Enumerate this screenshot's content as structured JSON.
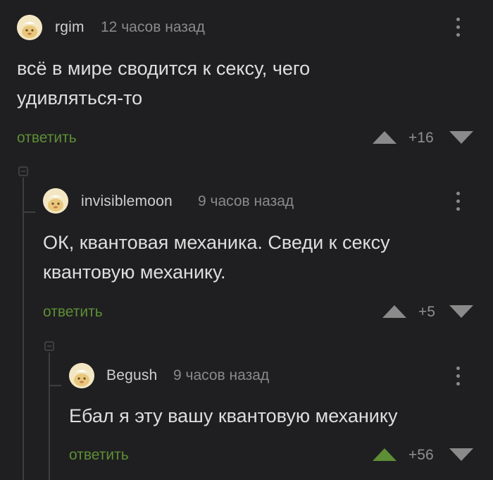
{
  "comments": [
    {
      "username": "rgim",
      "time": "12 часов назад",
      "text": "всё в мире сводится к сексу, чего удивляться-то",
      "reply_label": "ответить",
      "rating": "+16",
      "upvoted": false
    },
    {
      "username": "invisiblemoon",
      "time": "9 часов назад",
      "text": "ОК, квантовая механика. Сведи к сексу квантовую механику.",
      "reply_label": "ответить",
      "rating": "+5",
      "upvoted": false
    },
    {
      "username": "Begush",
      "time": "9 часов назад",
      "text": "Ебал я эту вашу квантовую механику",
      "reply_label": "ответить",
      "rating": "+56",
      "upvoted": true
    }
  ],
  "colors": {
    "background": "#1f1f21",
    "reply_link": "#5e8e35",
    "upvote_active": "#5e8e35",
    "vote_inactive": "#8a8a8a",
    "thread_line": "#3e3e40"
  },
  "icons": [
    "avatar-image",
    "more-vertical-icon",
    "arrow-up-icon",
    "arrow-down-icon",
    "collapse-thread-icon"
  ]
}
